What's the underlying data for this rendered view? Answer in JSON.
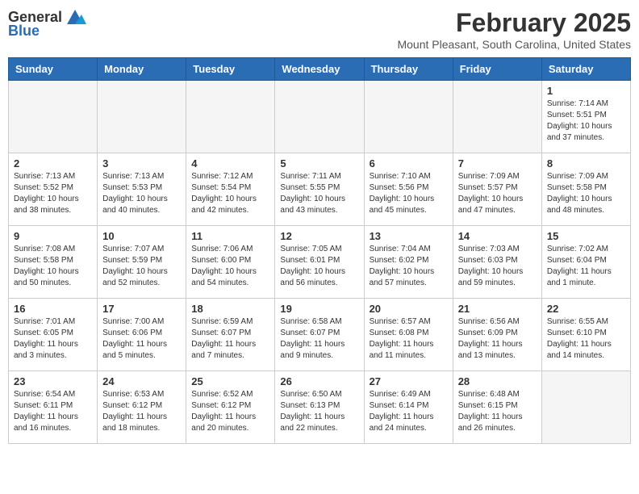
{
  "header": {
    "logo_general": "General",
    "logo_blue": "Blue",
    "title": "February 2025",
    "subtitle": "Mount Pleasant, South Carolina, United States"
  },
  "weekdays": [
    "Sunday",
    "Monday",
    "Tuesday",
    "Wednesday",
    "Thursday",
    "Friday",
    "Saturday"
  ],
  "weeks": [
    [
      {
        "day": "",
        "info": ""
      },
      {
        "day": "",
        "info": ""
      },
      {
        "day": "",
        "info": ""
      },
      {
        "day": "",
        "info": ""
      },
      {
        "day": "",
        "info": ""
      },
      {
        "day": "",
        "info": ""
      },
      {
        "day": "1",
        "info": "Sunrise: 7:14 AM\nSunset: 5:51 PM\nDaylight: 10 hours and 37 minutes."
      }
    ],
    [
      {
        "day": "2",
        "info": "Sunrise: 7:13 AM\nSunset: 5:52 PM\nDaylight: 10 hours and 38 minutes."
      },
      {
        "day": "3",
        "info": "Sunrise: 7:13 AM\nSunset: 5:53 PM\nDaylight: 10 hours and 40 minutes."
      },
      {
        "day": "4",
        "info": "Sunrise: 7:12 AM\nSunset: 5:54 PM\nDaylight: 10 hours and 42 minutes."
      },
      {
        "day": "5",
        "info": "Sunrise: 7:11 AM\nSunset: 5:55 PM\nDaylight: 10 hours and 43 minutes."
      },
      {
        "day": "6",
        "info": "Sunrise: 7:10 AM\nSunset: 5:56 PM\nDaylight: 10 hours and 45 minutes."
      },
      {
        "day": "7",
        "info": "Sunrise: 7:09 AM\nSunset: 5:57 PM\nDaylight: 10 hours and 47 minutes."
      },
      {
        "day": "8",
        "info": "Sunrise: 7:09 AM\nSunset: 5:58 PM\nDaylight: 10 hours and 48 minutes."
      }
    ],
    [
      {
        "day": "9",
        "info": "Sunrise: 7:08 AM\nSunset: 5:58 PM\nDaylight: 10 hours and 50 minutes."
      },
      {
        "day": "10",
        "info": "Sunrise: 7:07 AM\nSunset: 5:59 PM\nDaylight: 10 hours and 52 minutes."
      },
      {
        "day": "11",
        "info": "Sunrise: 7:06 AM\nSunset: 6:00 PM\nDaylight: 10 hours and 54 minutes."
      },
      {
        "day": "12",
        "info": "Sunrise: 7:05 AM\nSunset: 6:01 PM\nDaylight: 10 hours and 56 minutes."
      },
      {
        "day": "13",
        "info": "Sunrise: 7:04 AM\nSunset: 6:02 PM\nDaylight: 10 hours and 57 minutes."
      },
      {
        "day": "14",
        "info": "Sunrise: 7:03 AM\nSunset: 6:03 PM\nDaylight: 10 hours and 59 minutes."
      },
      {
        "day": "15",
        "info": "Sunrise: 7:02 AM\nSunset: 6:04 PM\nDaylight: 11 hours and 1 minute."
      }
    ],
    [
      {
        "day": "16",
        "info": "Sunrise: 7:01 AM\nSunset: 6:05 PM\nDaylight: 11 hours and 3 minutes."
      },
      {
        "day": "17",
        "info": "Sunrise: 7:00 AM\nSunset: 6:06 PM\nDaylight: 11 hours and 5 minutes."
      },
      {
        "day": "18",
        "info": "Sunrise: 6:59 AM\nSunset: 6:07 PM\nDaylight: 11 hours and 7 minutes."
      },
      {
        "day": "19",
        "info": "Sunrise: 6:58 AM\nSunset: 6:07 PM\nDaylight: 11 hours and 9 minutes."
      },
      {
        "day": "20",
        "info": "Sunrise: 6:57 AM\nSunset: 6:08 PM\nDaylight: 11 hours and 11 minutes."
      },
      {
        "day": "21",
        "info": "Sunrise: 6:56 AM\nSunset: 6:09 PM\nDaylight: 11 hours and 13 minutes."
      },
      {
        "day": "22",
        "info": "Sunrise: 6:55 AM\nSunset: 6:10 PM\nDaylight: 11 hours and 14 minutes."
      }
    ],
    [
      {
        "day": "23",
        "info": "Sunrise: 6:54 AM\nSunset: 6:11 PM\nDaylight: 11 hours and 16 minutes."
      },
      {
        "day": "24",
        "info": "Sunrise: 6:53 AM\nSunset: 6:12 PM\nDaylight: 11 hours and 18 minutes."
      },
      {
        "day": "25",
        "info": "Sunrise: 6:52 AM\nSunset: 6:12 PM\nDaylight: 11 hours and 20 minutes."
      },
      {
        "day": "26",
        "info": "Sunrise: 6:50 AM\nSunset: 6:13 PM\nDaylight: 11 hours and 22 minutes."
      },
      {
        "day": "27",
        "info": "Sunrise: 6:49 AM\nSunset: 6:14 PM\nDaylight: 11 hours and 24 minutes."
      },
      {
        "day": "28",
        "info": "Sunrise: 6:48 AM\nSunset: 6:15 PM\nDaylight: 11 hours and 26 minutes."
      },
      {
        "day": "",
        "info": ""
      }
    ]
  ]
}
